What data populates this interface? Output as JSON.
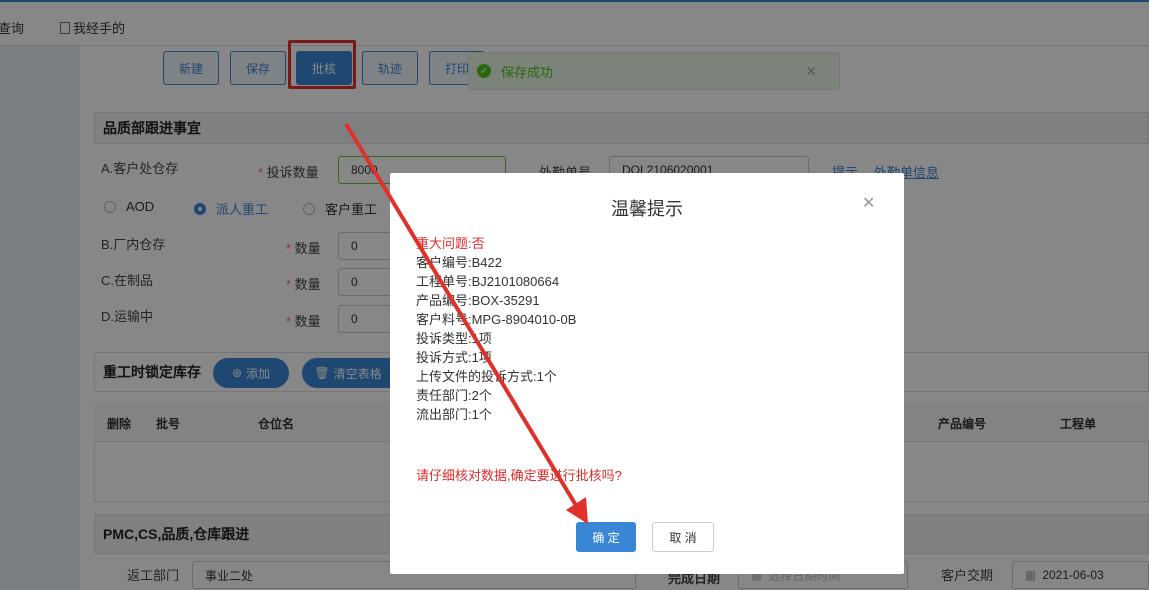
{
  "tabs": {
    "query": "查询",
    "mine": "我经手的"
  },
  "toolbar": {
    "new": "新建",
    "save": "保存",
    "approve": "批核",
    "track": "轨迹",
    "print": "打印"
  },
  "toast": {
    "message": "保存成功"
  },
  "qa_section": {
    "title": "品质部跟进事宜",
    "a_label": "A.客户处仓存",
    "complaint_qty_label": "投诉数量",
    "complaint_qty": "8000",
    "outsource_no_label": "外勤单号",
    "outsource_no": "DQL2106020001",
    "hint_link": "提示",
    "outsource_info_link": "外勤单信息",
    "radio_aod": "AOD",
    "radio_dispatch": "派人重工",
    "radio_customer": "客户重工",
    "b_label": "B.厂内仓存",
    "c_label": "C.在制品",
    "d_label": "D.运输中",
    "qty_label": "数量",
    "qty_b": "0",
    "qty_c": "0",
    "qty_d": "0"
  },
  "rework_section": {
    "title": "重工时锁定库存",
    "add_button": "添加",
    "clear_button": "清空表格",
    "columns": {
      "delete": "删除",
      "batch": "批号",
      "location": "仓位名",
      "product_no": "产品编号",
      "job_no": "工程单"
    }
  },
  "pmc_section": {
    "title": "PMC,CS,品质,仓库跟进",
    "return_dept_label": "返工部门",
    "return_dept_value": "事业二处",
    "completion_date_label": "完成日期",
    "completion_date_placeholder": "选择日期时间",
    "customer_date_label": "客户交期",
    "customer_date_value": "2021-06-03"
  },
  "dialog": {
    "title": "温馨提示",
    "major_issue": "重大问题:否",
    "lines": [
      "客户编号:B422",
      "工程单号:BJ2101080664",
      "产品编号:BOX-35291",
      "客户料号:MPG-8904010-0B",
      "投诉类型:1项",
      "投诉方式:1项",
      "上传文件的投诉方式:1个",
      "责任部门:2个",
      "流出部门:1个"
    ],
    "confirm_question": "请仔细核对数据,确定要进行批核吗?",
    "ok": "确 定",
    "cancel": "取 消"
  },
  "colors": {
    "accent": "#3a86d6",
    "highlight": "#e0302a",
    "warning_text": "#e02b2b",
    "success": "#52c41a"
  },
  "icons": {
    "doc": "doc-icon",
    "plus": "plus-circle-icon",
    "trash": "trash-icon",
    "calendar": "calendar-icon",
    "close": "close-icon",
    "check": "check-circle-icon"
  }
}
